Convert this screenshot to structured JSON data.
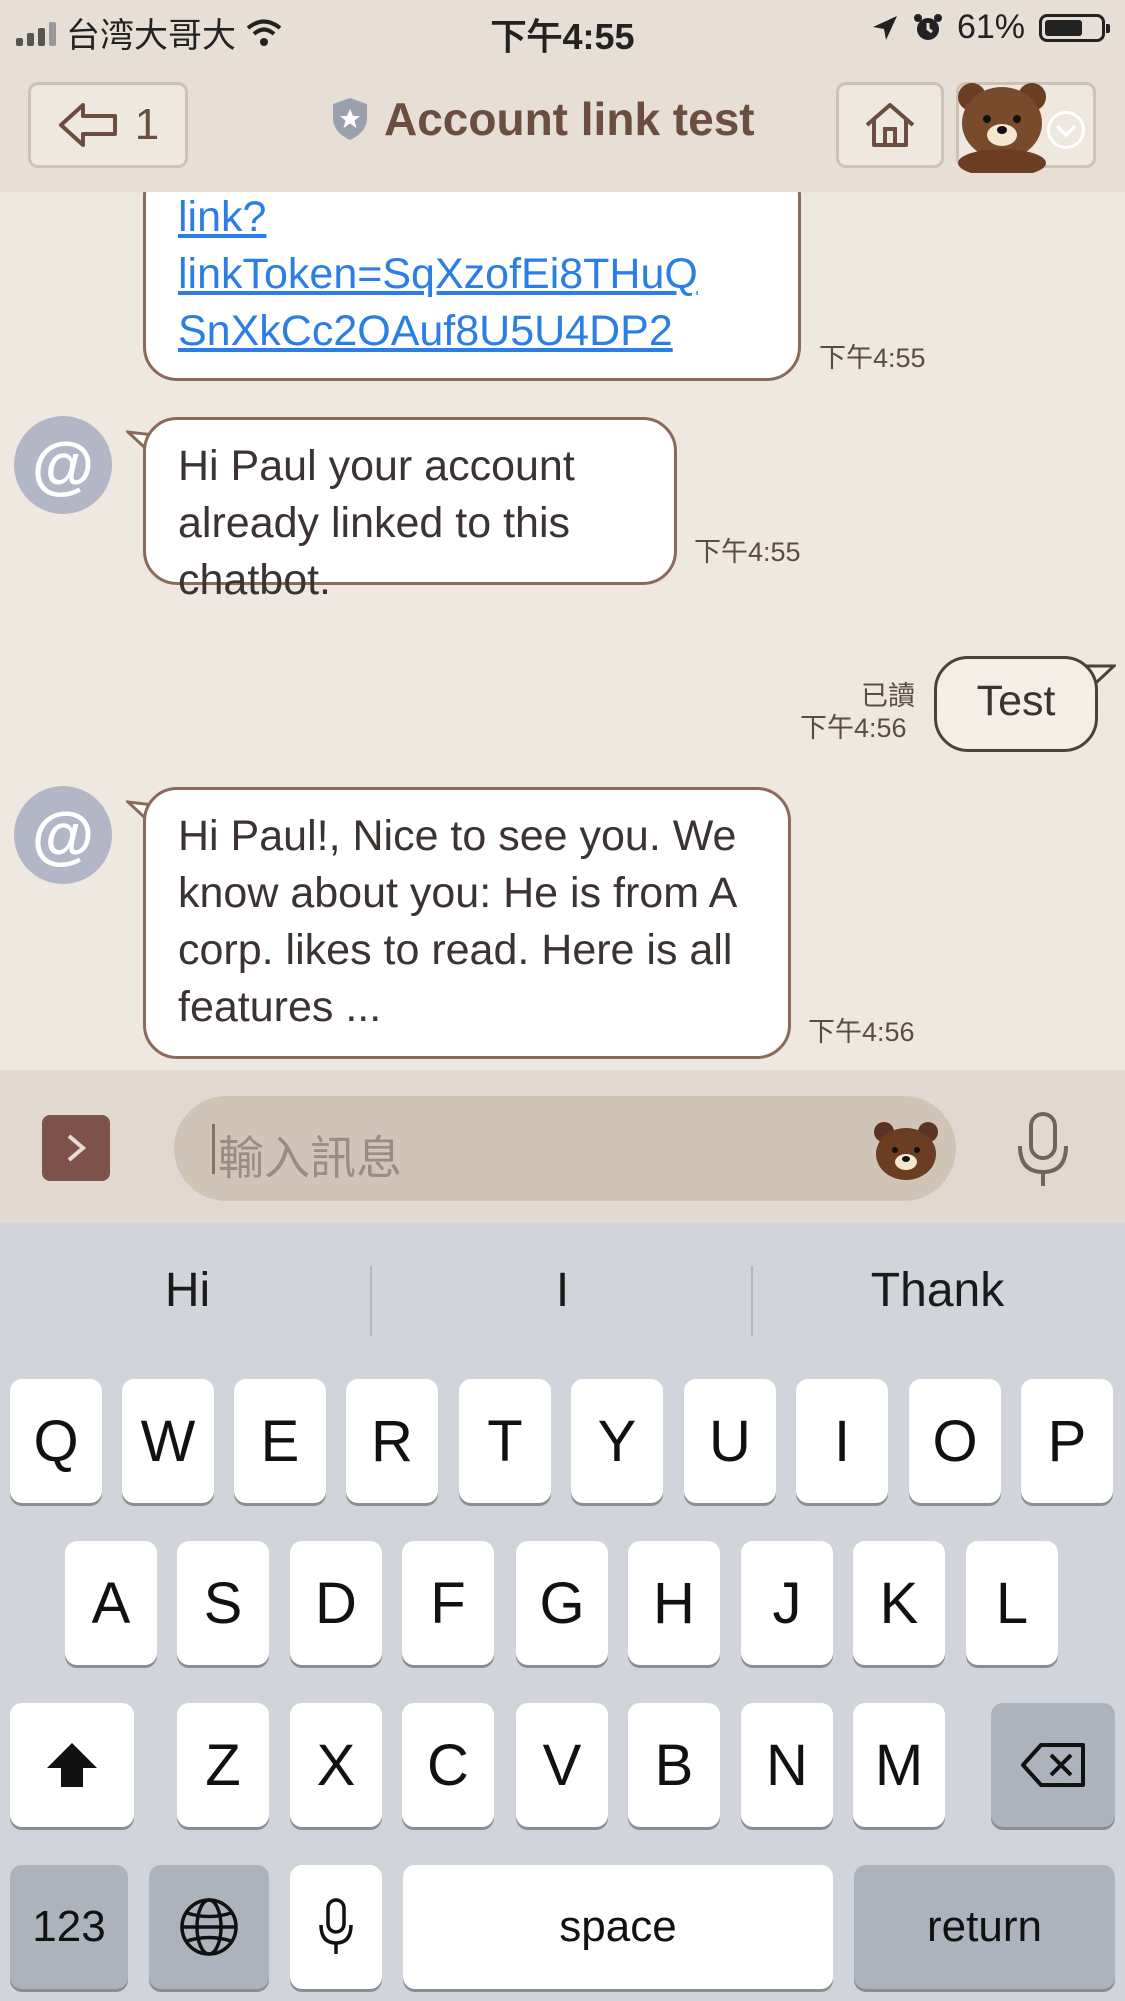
{
  "status_bar": {
    "carrier": "台湾大哥大",
    "time": "下午4:55",
    "battery": "61%"
  },
  "header": {
    "back_count": "1",
    "title": "Account link test"
  },
  "messages": [
    {
      "text": "link?\nlinkToken=SqXzofEi8THuQ\nSnXkCc2OAuf8U5U4DP2",
      "time": "下午4:55"
    },
    {
      "text": "Hi Paul your account already linked to this chatbot.",
      "time": "下午4:55"
    },
    {
      "text": "Test",
      "read": "已讀",
      "time": "下午4:56"
    },
    {
      "text": "Hi Paul!, Nice to see you. We know about you: He is from A corp. likes to read. Here is all features ...",
      "time": "下午4:56"
    }
  ],
  "composer": {
    "placeholder": "輸入訊息"
  },
  "keyboard": {
    "suggestions": [
      "Hi",
      "I",
      "Thank"
    ],
    "row1": [
      "Q",
      "W",
      "E",
      "R",
      "T",
      "Y",
      "U",
      "I",
      "O",
      "P"
    ],
    "row2": [
      "A",
      "S",
      "D",
      "F",
      "G",
      "H",
      "J",
      "K",
      "L"
    ],
    "row3": [
      "Z",
      "X",
      "C",
      "V",
      "B",
      "N",
      "M"
    ],
    "numbers_label": "123",
    "space_label": "space",
    "return_label": "return"
  }
}
